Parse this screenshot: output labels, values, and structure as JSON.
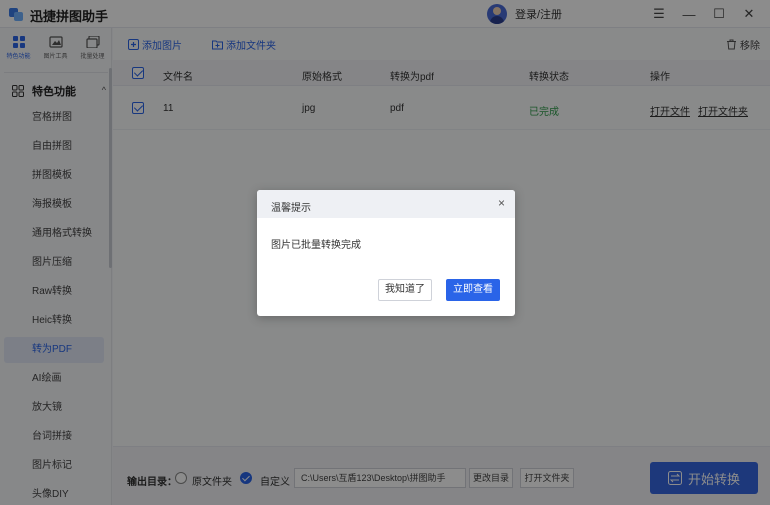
{
  "app": {
    "title": "迅捷拼图助手",
    "login": "登录/注册"
  },
  "window_controls": [
    "☰",
    "—",
    "☐",
    "✕"
  ],
  "sidebar": {
    "tools": [
      {
        "label": "特色功能",
        "icon": "grid-icon"
      },
      {
        "label": "图片工具",
        "icon": "image-tool-icon"
      },
      {
        "label": "批量处理",
        "icon": "batch-icon"
      }
    ],
    "section_label": "特色功能",
    "items": [
      {
        "label": "宫格拼图"
      },
      {
        "label": "自由拼图"
      },
      {
        "label": "拼图模板"
      },
      {
        "label": "海报模板"
      },
      {
        "label": "通用格式转换"
      },
      {
        "label": "图片压缩"
      },
      {
        "label": "Raw转换"
      },
      {
        "label": "Heic转换"
      },
      {
        "label": "转为PDF"
      },
      {
        "label": "AI绘画"
      },
      {
        "label": "放大镜"
      },
      {
        "label": "台词拼接"
      },
      {
        "label": "图片标记"
      },
      {
        "label": "头像DIY"
      }
    ]
  },
  "toolbar": {
    "add_image": "添加图片",
    "add_folder": "添加文件夹",
    "remove": "移除"
  },
  "table": {
    "headers": {
      "name": "文件名",
      "format": "原始格式",
      "target": "转换为pdf",
      "status": "转换状态",
      "action": "操作"
    },
    "rows": [
      {
        "name": "11",
        "format": "jpg",
        "target": "pdf",
        "status": "已完成",
        "open_file": "打开文件",
        "open_folder": "打开文件夹"
      }
    ]
  },
  "bottom": {
    "output_label": "输出目录：",
    "original_folder": "原文件夹",
    "custom": "自定义",
    "path": "C:\\Users\\互盾123\\Desktop\\拼图助手",
    "change_dir": "更改目录",
    "open_folder": "打开文件夹",
    "start": "开始转换"
  },
  "dialog": {
    "title": "温馨提示",
    "close": "×",
    "message": "图片已批量转换完成",
    "ok": "我知道了",
    "view": "立即查看"
  },
  "colors": {
    "accent": "#2a64e8",
    "success": "#2e9b4a",
    "overlay": "rgba(0,0,0,0.45)"
  }
}
